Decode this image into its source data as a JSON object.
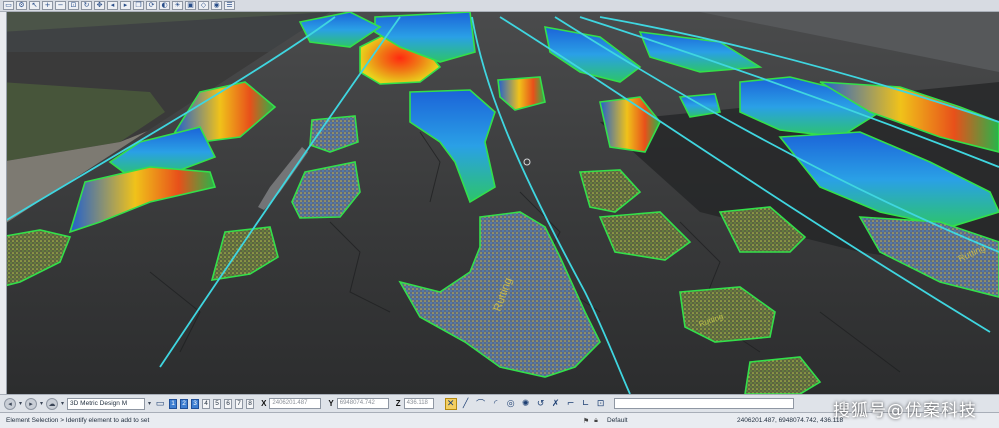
{
  "toolbar": {
    "icons": [
      "window-menu-icon",
      "settings-icon",
      "element-select-icon",
      "zoom-in-icon",
      "zoom-out-icon",
      "fit-view-icon",
      "rotate-view-icon",
      "pan-icon",
      "view-previous-icon",
      "view-next-icon",
      "copy-view-icon",
      "update-view-icon",
      "display-style-icon",
      "render-icon",
      "clip-volume-icon",
      "toggle-3d-icon",
      "camera-icon",
      "view-attributes-icon"
    ]
  },
  "viewport": {
    "description_colors": {
      "boundary": "#33e04a",
      "lane_lines": "#3fd6e0",
      "heat_high": "#e83218",
      "heat_mid": "#f2c51d",
      "heat_low": "#2a6fd6"
    },
    "annotations": [
      "Rutting",
      "Rutting",
      "Rutting"
    ]
  },
  "bottom_toolbar": {
    "model_name": "3D Metric Design M",
    "view_buttons": [
      "1",
      "2",
      "3",
      "4",
      "5",
      "6",
      "7",
      "8"
    ],
    "active_views": [
      "1",
      "2",
      "3"
    ],
    "x_label": "X",
    "x_value": "2406201.487",
    "y_label": "Y",
    "y_value": "6948074.742",
    "z_label": "Z",
    "z_value": "436.118"
  },
  "status_bar": {
    "message": "Element Selection > Identify element to add to set",
    "level": "Default",
    "coordinates": "2406201.487, 6948074.742, 436.118"
  },
  "watermark": "搜狐号@优案科技"
}
